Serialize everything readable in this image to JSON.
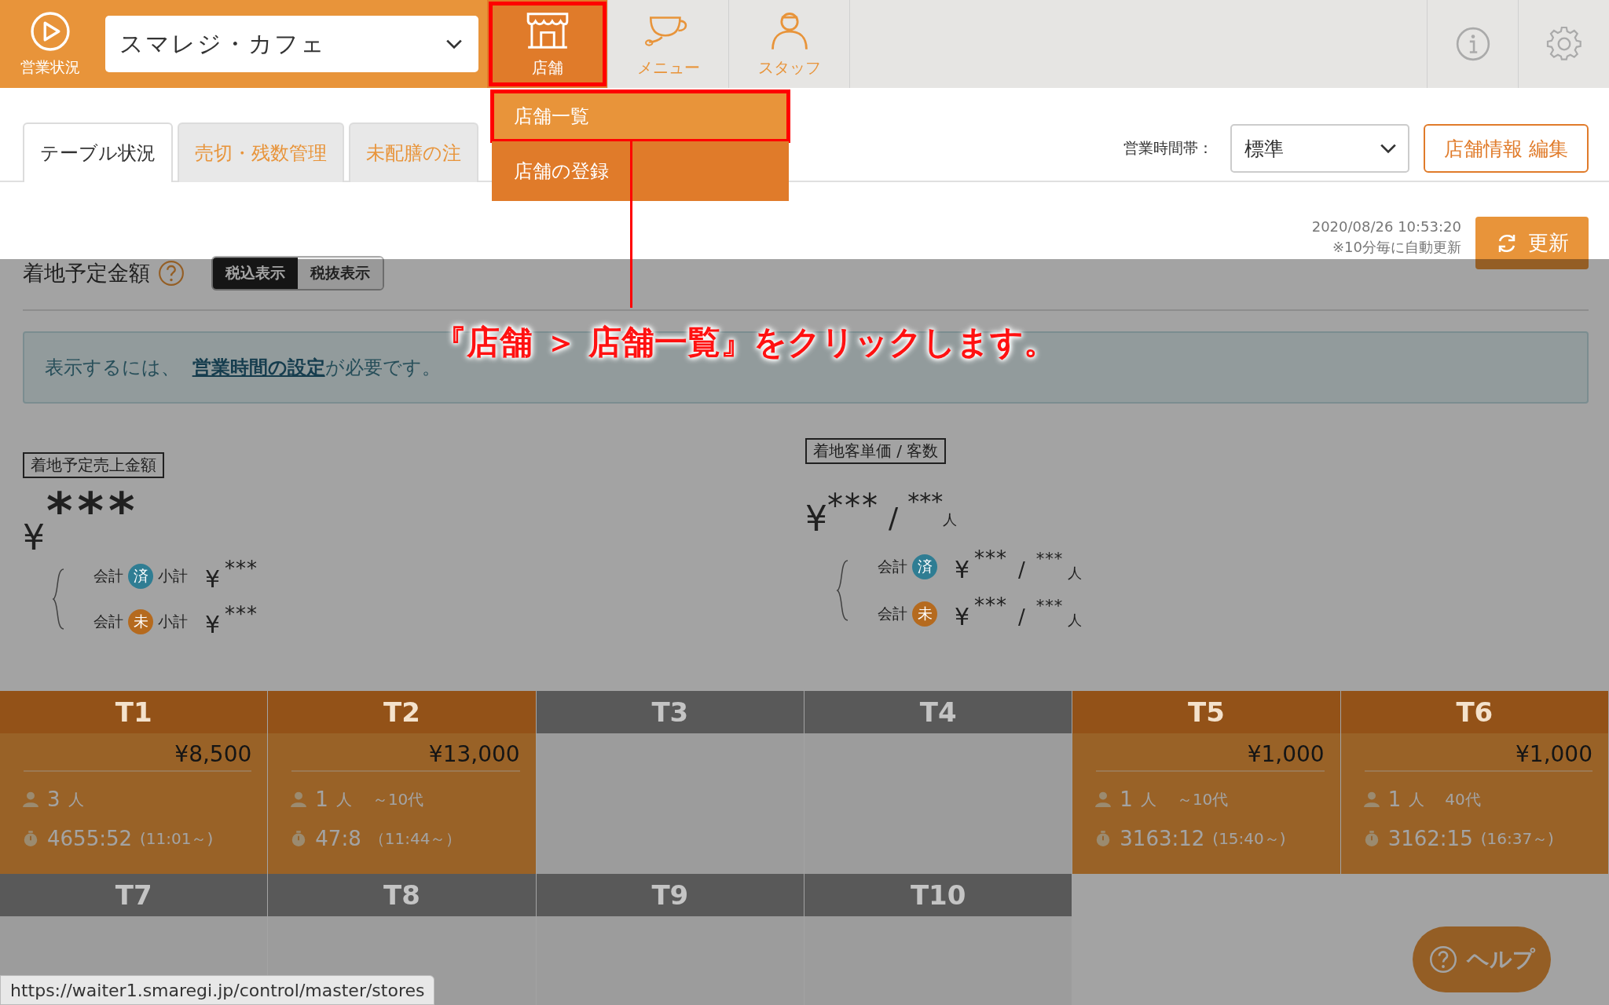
{
  "header": {
    "status_label": "営業状況",
    "store_select": "スマレジ・カフェ",
    "nav": [
      {
        "kind": "store",
        "label": "店舗",
        "selected": true,
        "highlighted": true
      },
      {
        "kind": "menu",
        "label": "メニュー",
        "selected": false,
        "highlighted": false
      },
      {
        "kind": "staff",
        "label": "スタッフ",
        "selected": false,
        "highlighted": false
      }
    ]
  },
  "nav_dropdown": [
    {
      "label": "店舗一覧",
      "highlighted": true
    },
    {
      "label": "店舗の登録",
      "highlighted": false
    }
  ],
  "tabs": [
    {
      "label": "テーブル状況",
      "selected": true
    },
    {
      "label": "売切・残数管理",
      "selected": false
    },
    {
      "label": "未配膳の注",
      "selected": false
    }
  ],
  "toolbar": {
    "hours_label": "営業時間帯：",
    "hours_select": "標準",
    "edit_button": "店舗情報 編集",
    "timestamp": "2020/08/26 10:53:20",
    "auto_update_note": "※10分毎に自動更新",
    "refresh_button": "更新"
  },
  "forecast": {
    "title": "着地予定金額",
    "tax_toggle": [
      {
        "label": "税込表示",
        "selected": true
      },
      {
        "label": "税抜表示",
        "selected": false
      }
    ],
    "notice": {
      "text": "表示するには、 ",
      "link": "営業時間の設定",
      "suffix": "が必要です。"
    },
    "sales": {
      "label": "着地予定売上金額",
      "currency": "¥",
      "value": "***",
      "rows": [
        {
          "prefix": "会計",
          "badge": "済",
          "color": "#2f7d93",
          "suffix": "小計",
          "currency": "¥",
          "value": "***"
        },
        {
          "prefix": "会計",
          "badge": "未",
          "color": "#b56a1e",
          "suffix": "小計",
          "currency": "¥",
          "value": "***"
        }
      ]
    },
    "per_customer": {
      "label": "着地客単価 / 客数",
      "currency": "¥",
      "amount": "***",
      "separator": "/",
      "count": "***",
      "unit": "人",
      "rows": [
        {
          "prefix": "会計",
          "badge": "済",
          "color": "#2f7d93",
          "currency": "¥",
          "amount": "***",
          "separator": "/",
          "count": "***",
          "unit": "人"
        },
        {
          "prefix": "会計",
          "badge": "未",
          "color": "#b56a1e",
          "currency": "¥",
          "amount": "***",
          "separator": "/",
          "count": "***",
          "unit": "人"
        }
      ]
    }
  },
  "annotation": "『店舗 ＞ 店舗一覧』をクリックします。",
  "tables": [
    {
      "name": "T1",
      "occupied": true,
      "amount": "¥8,500",
      "guests": "3",
      "unit": "人",
      "elapsed": "4655:52",
      "since": "(11:01～)"
    },
    {
      "name": "T2",
      "occupied": true,
      "amount": "¥13,000",
      "guests": "1",
      "unit": "人",
      "age": "～10代",
      "elapsed": "47:8",
      "since": "（11:44～）"
    },
    {
      "name": "T3",
      "occupied": false
    },
    {
      "name": "T4",
      "occupied": false
    },
    {
      "name": "T5",
      "occupied": true,
      "amount": "¥1,000",
      "guests": "1",
      "unit": "人",
      "age": "～10代",
      "elapsed": "3163:12",
      "since": "(15:40～)"
    },
    {
      "name": "T6",
      "occupied": true,
      "amount": "¥1,000",
      "guests": "1",
      "unit": "人",
      "age": "40代",
      "elapsed": "3162:15",
      "since": "(16:37～)"
    },
    {
      "name": "T7",
      "occupied": false
    },
    {
      "name": "T8",
      "occupied": false
    },
    {
      "name": "T9",
      "occupied": false
    },
    {
      "name": "T10",
      "occupied": false
    }
  ],
  "help_button": "ヘルプ",
  "status_url": "https://waiter1.smaregi.jp/control/master/stores"
}
